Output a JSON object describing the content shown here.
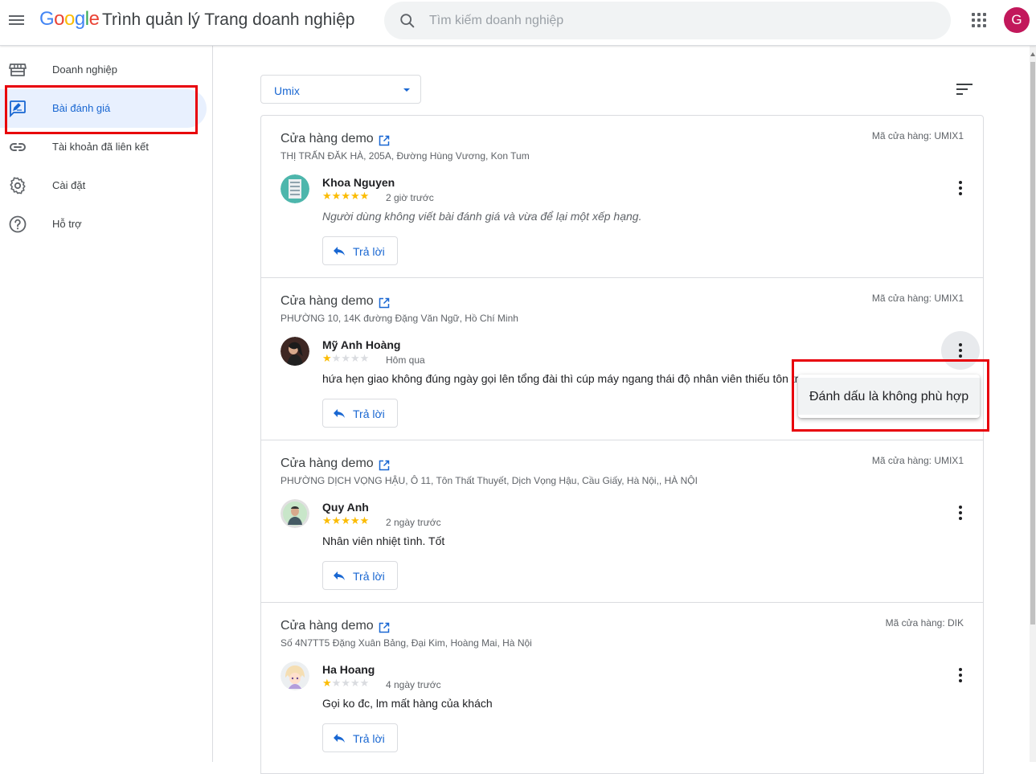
{
  "header": {
    "logo": [
      "G",
      "o",
      "o",
      "g",
      "l",
      "e"
    ],
    "app_title": "Trình quản lý Trang doanh nghiệp",
    "search_placeholder": "Tìm kiếm doanh nghiệp",
    "avatar_letter": "G",
    "avatar_color": "#c2185b"
  },
  "sidebar": {
    "items": [
      {
        "label": "Doanh nghiệp",
        "icon": "store-icon",
        "active": false
      },
      {
        "label": "Bài đánh giá",
        "icon": "rate-review-icon",
        "active": true
      },
      {
        "label": "Tài khoản đã liên kết",
        "icon": "link-icon",
        "active": false
      },
      {
        "label": "Cài đặt",
        "icon": "gear-icon",
        "active": false
      },
      {
        "label": "Hỗ trợ",
        "icon": "help-icon",
        "active": false
      }
    ]
  },
  "main": {
    "store_filter": "Umix",
    "sort_icon": "sort-icon",
    "reply_label": "Trả lời",
    "reviews": [
      {
        "store": "Cửa hàng demo",
        "address": "THỊ TRẤN ĐĂK HÀ, 205A, Đường Hùng Vương, Kon Tum",
        "code": "Mã cửa hàng: UMIX1",
        "reviewer": "Khoa Nguyen",
        "rating": 5,
        "time": "2 giờ trước",
        "text": "Người dùng không viết bài đánh giá và vừa để lại một xếp hạng."
      },
      {
        "store": "Cửa hàng demo",
        "address": "PHƯỜNG 10, 14K đường Đặng Văn Ngữ, Hồ Chí Minh",
        "code": "Mã cửa hàng: UMIX1",
        "reviewer": "Mỹ Anh Hoàng",
        "rating": 1,
        "time": "Hôm qua",
        "text": "hứa hẹn giao không đúng ngày gọi lên tổng đài thì cúp máy ngang thái độ nhân viên thiếu tôn tr"
      },
      {
        "store": "Cửa hàng demo",
        "address": "PHƯỜNG DỊCH VỌNG HẬU, Ô 11, Tôn Thất Thuyết, Dịch Vọng Hậu, Cầu Giấy, Hà Nội,, HÀ NỘI",
        "code": "Mã cửa hàng: UMIX1",
        "reviewer": "Quy Anh",
        "rating": 5,
        "time": "2 ngày trước",
        "text": "Nhân viên nhiệt tình. Tốt"
      },
      {
        "store": "Cửa hàng demo",
        "address": "Số 4N7TT5 Đặng Xuân Bảng, Đại Kim, Hoàng Mai, Hà Nội",
        "code": "Mã cửa hàng: DIK",
        "reviewer": "Ha Hoang",
        "rating": 1,
        "time": "4 ngày trước",
        "text": "Gọi ko đc, lm mất hàng của khách"
      }
    ],
    "popup_menu": {
      "item": "Đánh dấu là không phù hợp"
    }
  },
  "colors": {
    "accent": "#1967d2",
    "star": "#fbbc04",
    "highlight_box": "#e8000b"
  }
}
